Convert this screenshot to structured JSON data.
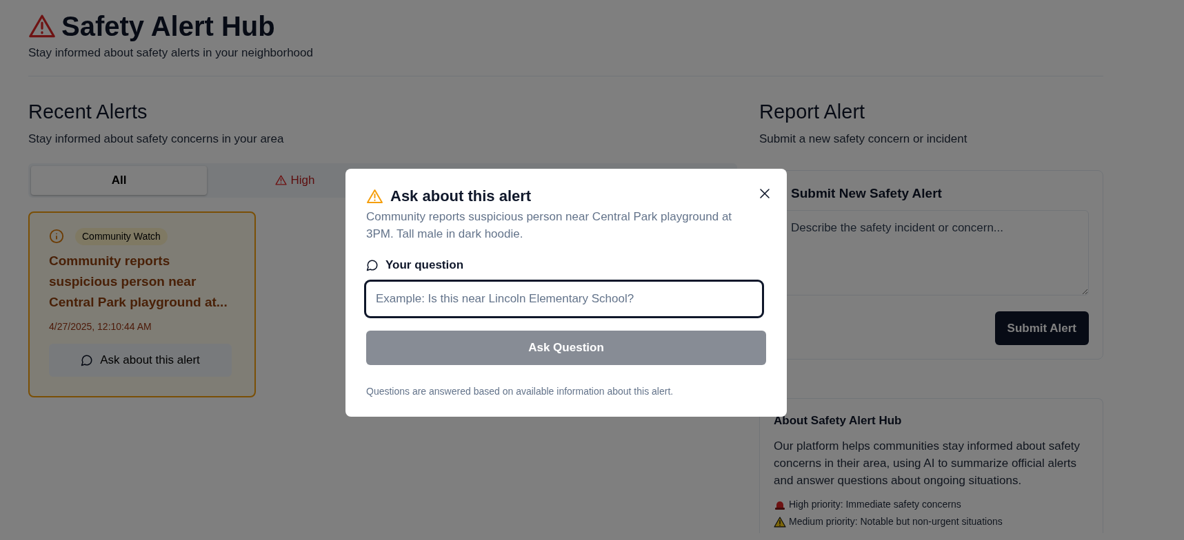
{
  "header": {
    "title": "Safety Alert Hub",
    "subtitle": "Stay informed about safety alerts in your neighborhood"
  },
  "alerts_section": {
    "title": "Recent Alerts",
    "subtitle": "Stay informed about safety concerns in your area",
    "tabs": [
      {
        "label": "All",
        "selected": true,
        "kind": "plain"
      },
      {
        "label": "High",
        "selected": false,
        "kind": "high"
      }
    ],
    "alerts": [
      {
        "source": "Community Watch",
        "title": "Community reports suspicious person near Central Park playground at...",
        "time": "4/27/2025, 12:10:44 AM",
        "ask_button": "Ask about this alert"
      }
    ]
  },
  "report_section": {
    "title": "Report Alert",
    "subtitle": "Submit a new safety concern or incident",
    "form": {
      "title": "Submit New Safety Alert",
      "placeholder": "Describe the safety incident or concern...",
      "submit_button": "Submit Alert"
    }
  },
  "about": {
    "title": "About Safety Alert Hub",
    "text": "Our platform helps communities stay informed about safety concerns in their area, using AI to summarize official alerts and answer questions about ongoing situations.",
    "legend": [
      {
        "kind": "high",
        "text": "High priority: Immediate safety concerns"
      },
      {
        "kind": "medium",
        "text": "Medium priority: Notable but non-urgent situations"
      }
    ]
  },
  "dialog": {
    "title": "Ask about this alert",
    "description": "Community reports suspicious person near Central Park playground at 3PM. Tall male in dark hoodie.",
    "question_label": "Your question",
    "placeholder": "Example: Is this near Lincoln Elementary School?",
    "ask_button": {
      "label": "Ask Question",
      "disabled": true
    },
    "note": "Questions are answered based on available information about this alert."
  }
}
